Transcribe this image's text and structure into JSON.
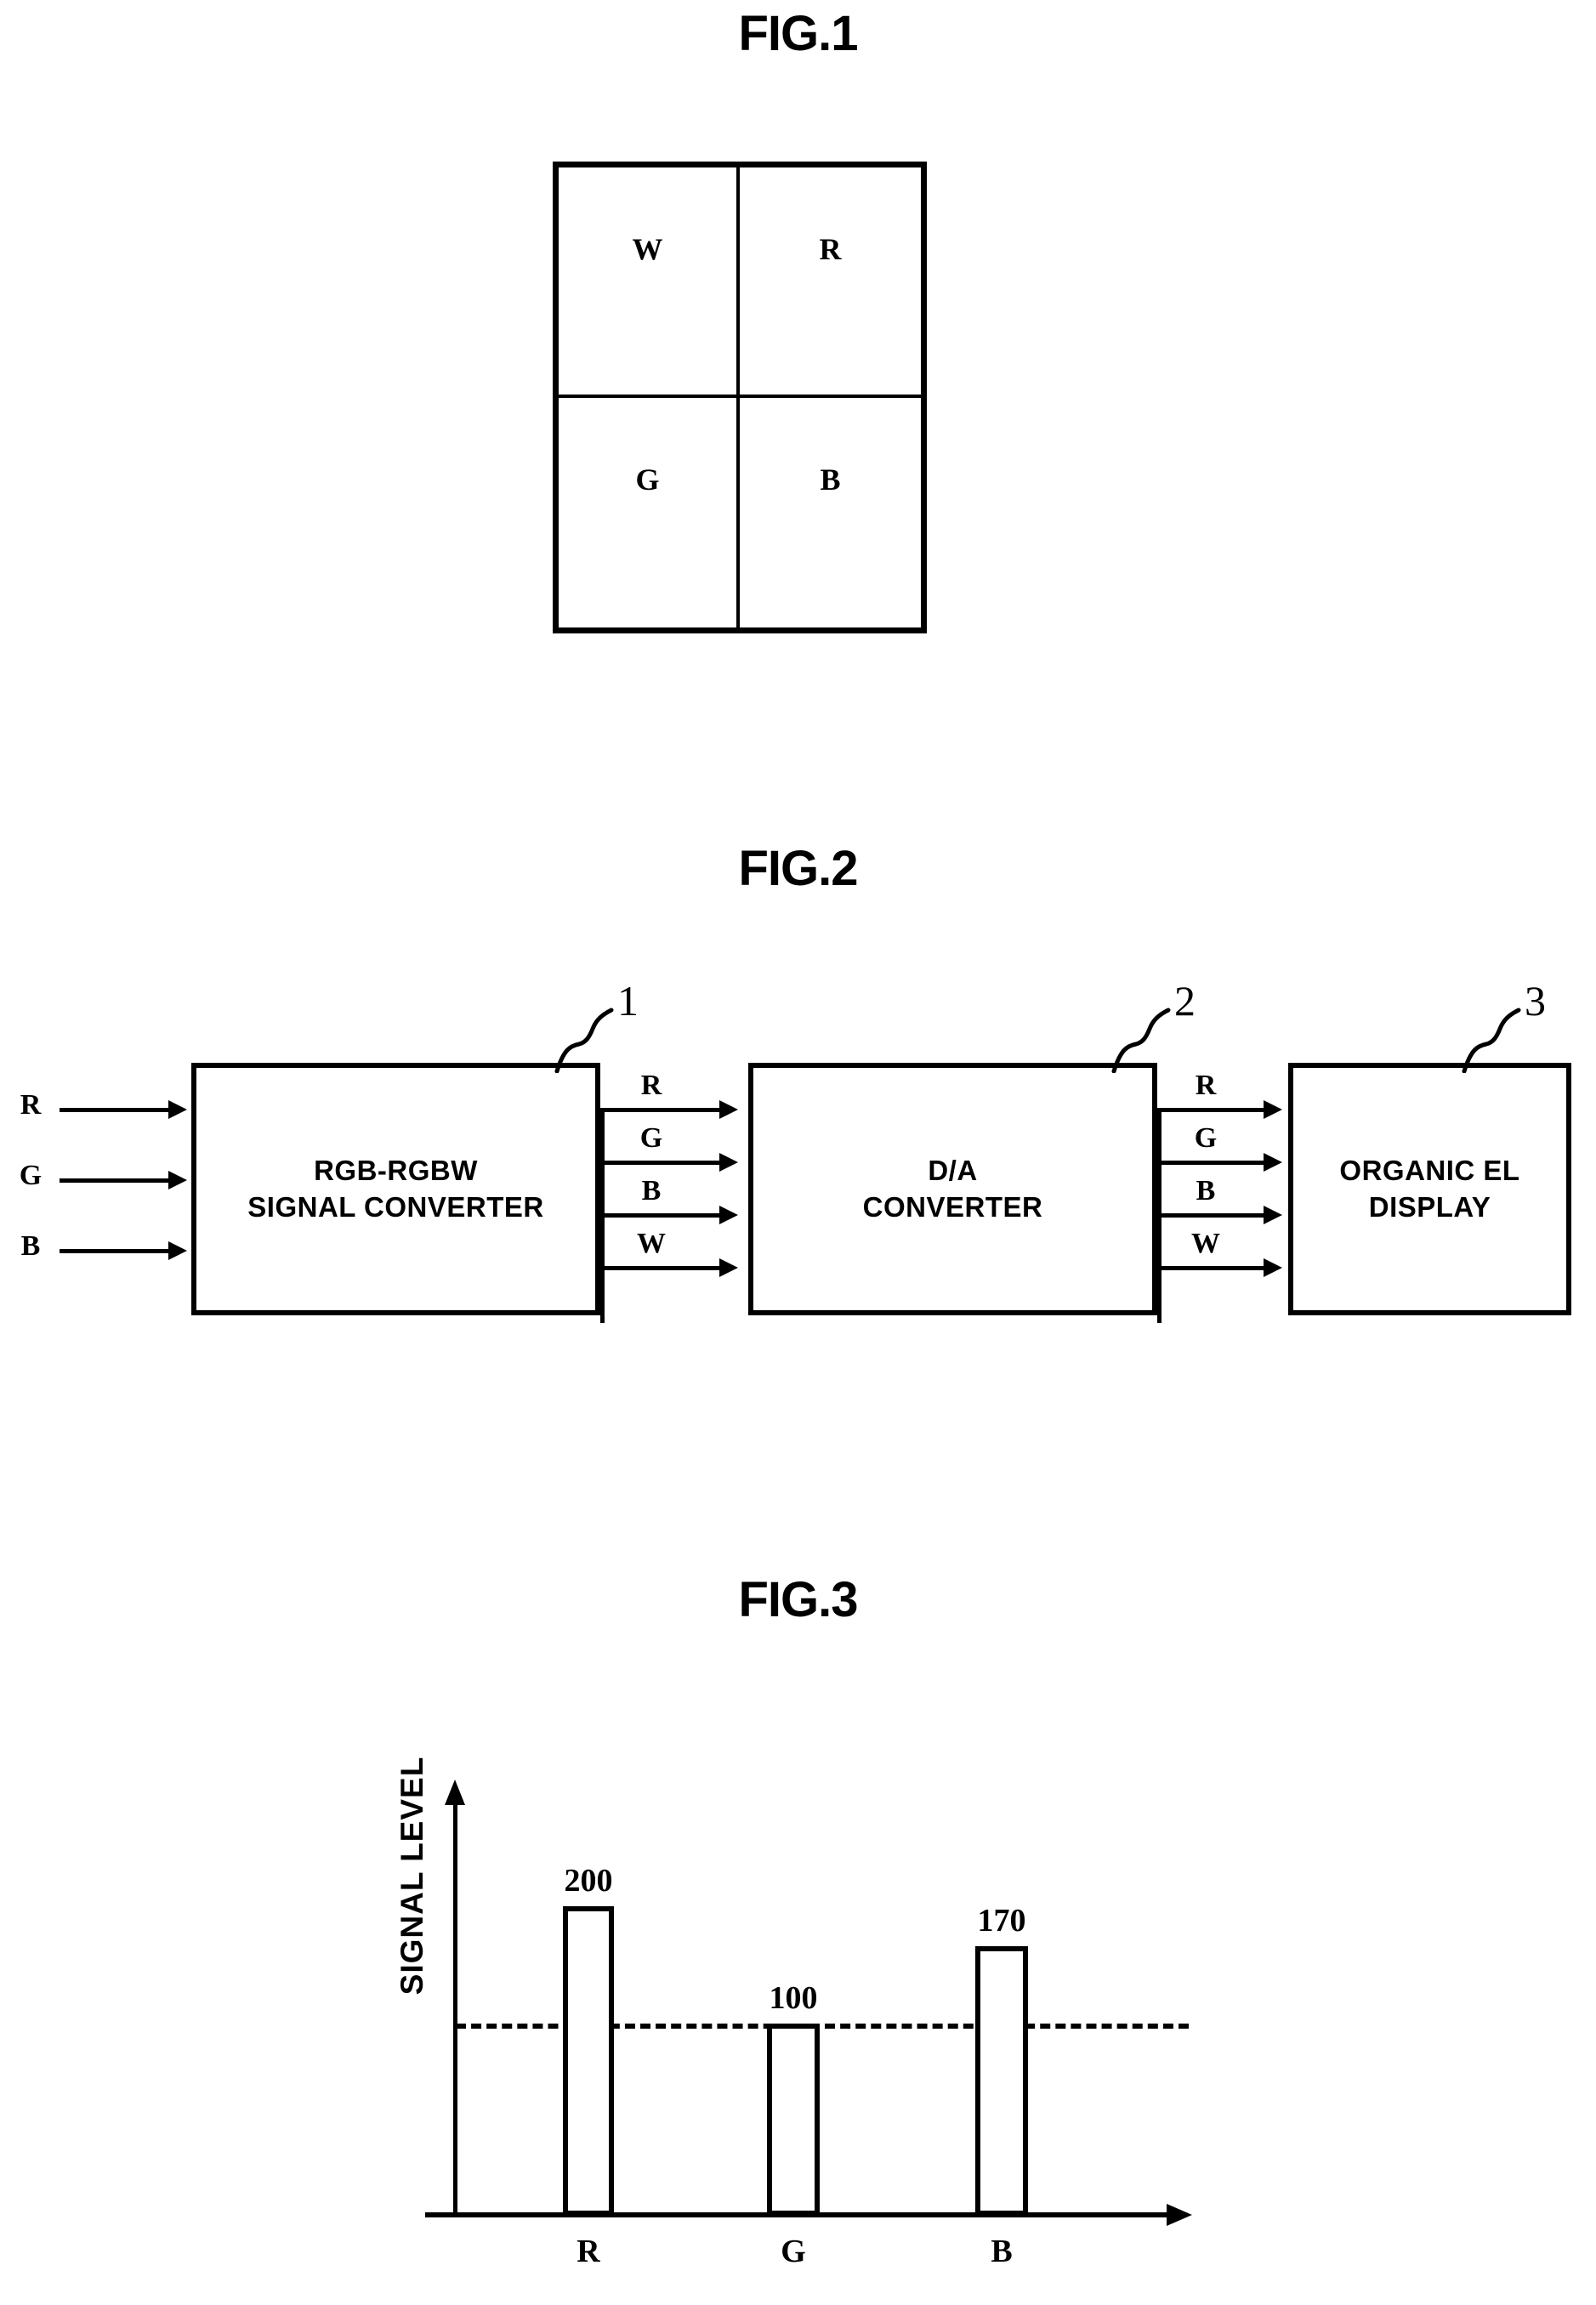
{
  "figures": [
    {
      "id": "fig1",
      "title": "FIG.1",
      "type": "pixel-layout",
      "cells": [
        {
          "label": "W"
        },
        {
          "label": "R"
        },
        {
          "label": "G"
        },
        {
          "label": "B"
        }
      ]
    },
    {
      "id": "fig2",
      "title": "FIG.2",
      "type": "block-diagram",
      "inputs": [
        {
          "label": "R"
        },
        {
          "label": "G"
        },
        {
          "label": "B"
        }
      ],
      "blocks": [
        {
          "ref": "1",
          "line1": "RGB-RGBW",
          "line2": "SIGNAL  CONVERTER"
        },
        {
          "ref": "2",
          "line1": "D/A",
          "line2": "CONVERTER"
        },
        {
          "ref": "3",
          "line1": "ORGANIC EL",
          "line2": "DISPLAY"
        }
      ],
      "bus1": [
        {
          "label": "R"
        },
        {
          "label": "G"
        },
        {
          "label": "B"
        },
        {
          "label": "W"
        }
      ],
      "bus2": [
        {
          "label": "R"
        },
        {
          "label": "G"
        },
        {
          "label": "B"
        },
        {
          "label": "W"
        }
      ]
    },
    {
      "id": "fig3",
      "title": "FIG.3",
      "type": "bar-chart"
    }
  ],
  "chart_data": {
    "type": "bar",
    "title": "FIG.3",
    "xlabel": "",
    "ylabel": "SIGNAL LEVEL",
    "categories": [
      "R",
      "G",
      "B"
    ],
    "values": [
      200,
      100,
      170
    ],
    "value_labels": [
      "200",
      "100",
      "170"
    ],
    "ylim": [
      0,
      230
    ],
    "grid": false,
    "legend": null,
    "annotations": [
      {
        "type": "reference-line",
        "style": "dashed",
        "value": 100,
        "orientation": "horizontal"
      }
    ],
    "axis_arrows": {
      "x": true,
      "y": true
    }
  }
}
